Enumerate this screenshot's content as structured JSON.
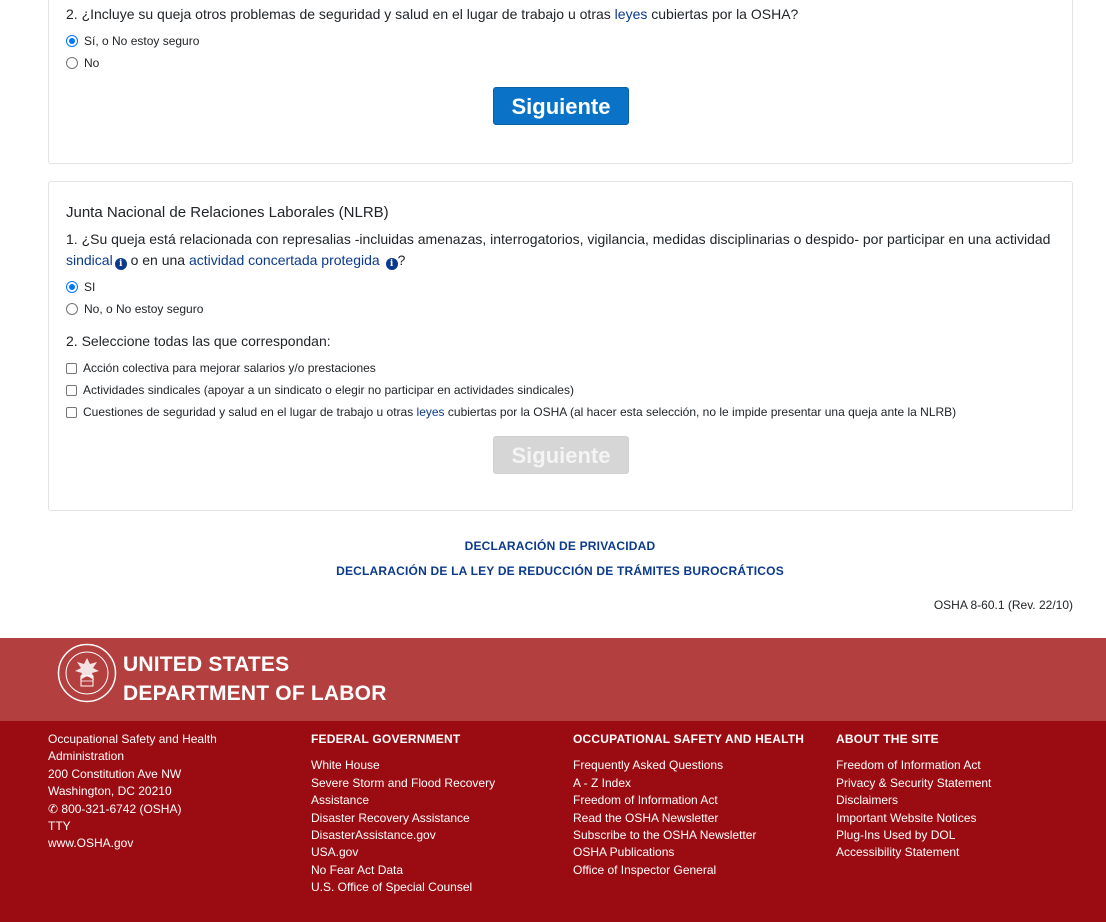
{
  "section1": {
    "q2": {
      "before": "2. ¿Incluye su queja otros problemas de seguridad y salud en el lugar de trabajo u otras ",
      "link": "leyes",
      "after": " cubiertas por la OSHA?"
    },
    "options": [
      "Sí, o No estoy seguro",
      "No"
    ],
    "selected": 0,
    "button": "Siguiente"
  },
  "section2": {
    "title": "Junta Nacional de Relaciones Laborales (NLRB)",
    "q1": {
      "line1": "1. ¿Su queja está relacionada con represalias -incluidas amenazas, interrogatorios, vigilancia, medidas disciplinarias o despido- por participar en una actividad",
      "link1": "sindical",
      "mid": " o en una ",
      "link2": "actividad concertada protegida",
      "end": "?"
    },
    "q1_options": [
      "SI",
      "No, o No estoy seguro"
    ],
    "q1_selected": 0,
    "q2": "2. Seleccione todas las que correspondan:",
    "checkboxes": [
      "Acción colectiva para mejorar salarios y/o prestaciones",
      "Actividades sindicales (apoyar a un sindicato o elegir no participar en actividades sindicales)",
      {
        "before": "Cuestiones de seguridad y salud en el lugar de trabajo u otras ",
        "link": "leyes",
        "after": " cubiertas por la OSHA (al hacer esta selección, no le impide presentar una queja ante la NLRB)"
      }
    ],
    "button": "Siguiente",
    "button_disabled": true
  },
  "links": {
    "privacy": "DECLARACIÓN DE PRIVACIDAD",
    "paperwork": "DECLARACIÓN DE LA LEY DE REDUCCIÓN DE TRÁMITES BUROCRÁTICOS"
  },
  "revision": "OSHA 8-60.1 (Rev. 22/10)",
  "brand": {
    "line1": "UNITED STATES",
    "line2": "DEPARTMENT OF LABOR",
    "seal_icon": "dol-seal-icon"
  },
  "footer": {
    "address": [
      "Occupational Safety and Health",
      "Administration",
      "200 Constitution Ave NW",
      "Washington, DC 20210",
      "800-321-6742 (OSHA)",
      "TTY",
      "www.OSHA.gov"
    ],
    "federal": {
      "title": "FEDERAL GOVERNMENT",
      "items": [
        "White House",
        "Severe Storm and Flood Recovery",
        "Assistance",
        "Disaster Recovery Assistance",
        "DisasterAssistance.gov",
        "USA.gov",
        "No Fear Act Data",
        "U.S. Office of Special Counsel"
      ]
    },
    "osha": {
      "title": "OCCUPATIONAL SAFETY AND HEALTH",
      "items": [
        "Frequently Asked Questions",
        "A - Z Index",
        "Freedom of Information Act",
        "Read the OSHA Newsletter",
        "Subscribe to the OSHA Newsletter",
        "OSHA Publications",
        "Office of Inspector General"
      ]
    },
    "about": {
      "title": "ABOUT THE SITE",
      "items": [
        "Freedom of Information Act",
        "Privacy & Security Statement",
        "Disclaimers",
        "Important Website Notices",
        "Plug-Ins Used by DOL",
        "Accessibility Statement"
      ]
    }
  },
  "colors": {
    "primary_button": "#0a73c8",
    "brand_band": "#b3403f",
    "footer_bg": "#9b0c12",
    "link": "#0b3a8c"
  }
}
